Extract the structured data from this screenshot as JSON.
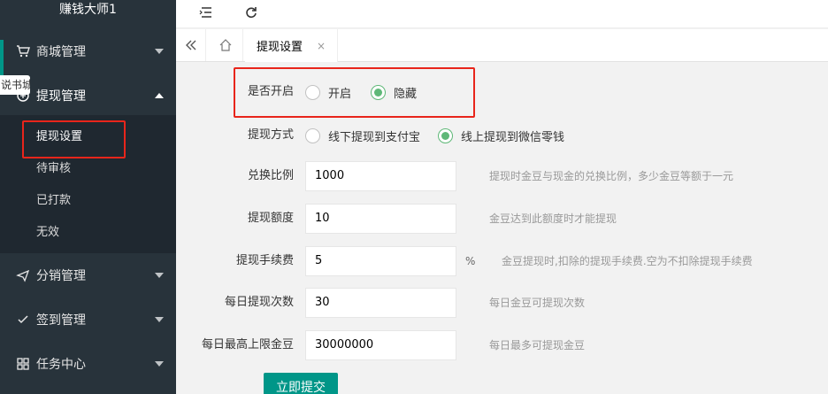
{
  "sidebar": {
    "logo": "赚钱大师1",
    "tooltip": "说书城",
    "items": [
      {
        "label": "商城管理",
        "icon": "cart-icon"
      },
      {
        "label": "提现管理",
        "icon": "circle-icon"
      },
      {
        "label": "分销管理",
        "icon": "send-icon"
      },
      {
        "label": "签到管理",
        "icon": "check-icon"
      },
      {
        "label": "任务中心",
        "icon": "grid-icon"
      }
    ],
    "submenu": [
      "提现设置",
      "待审核",
      "已打款",
      "无效"
    ]
  },
  "header": {
    "menu_icon": "menu-fold-icon",
    "refresh_icon": "refresh-icon"
  },
  "tabs": {
    "active": "提现设置",
    "close": "×"
  },
  "form": {
    "enable": {
      "label": "是否开启",
      "options": [
        "开启",
        "隐藏"
      ],
      "selected": "隐藏"
    },
    "method": {
      "label": "提现方式",
      "options": [
        "线下提现到支付宝",
        "线上提现到微信零钱"
      ],
      "selected": "线上提现到微信零钱"
    },
    "ratio": {
      "label": "兑换比例",
      "value": "1000",
      "hint": "提现时金豆与现金的兑换比例，多少金豆等额于一元"
    },
    "amount": {
      "label": "提现额度",
      "value": "10",
      "hint": "金豆达到此额度时才能提现"
    },
    "fee": {
      "label": "提现手续费",
      "value": "5",
      "unit": "%",
      "hint": "金豆提现时,扣除的提现手续费.空为不扣除提现手续费"
    },
    "daily_count": {
      "label": "每日提现次数",
      "value": "30",
      "hint": "每日金豆可提现次数"
    },
    "daily_max": {
      "label": "每日最高上限金豆",
      "value": "30000000",
      "hint": "每日最多可提现金豆"
    },
    "submit": "立即提交"
  },
  "colors": {
    "sidebar": "#28333b",
    "accent": "#009688",
    "radio": "#5fb878",
    "highlight": "#e8251b"
  }
}
